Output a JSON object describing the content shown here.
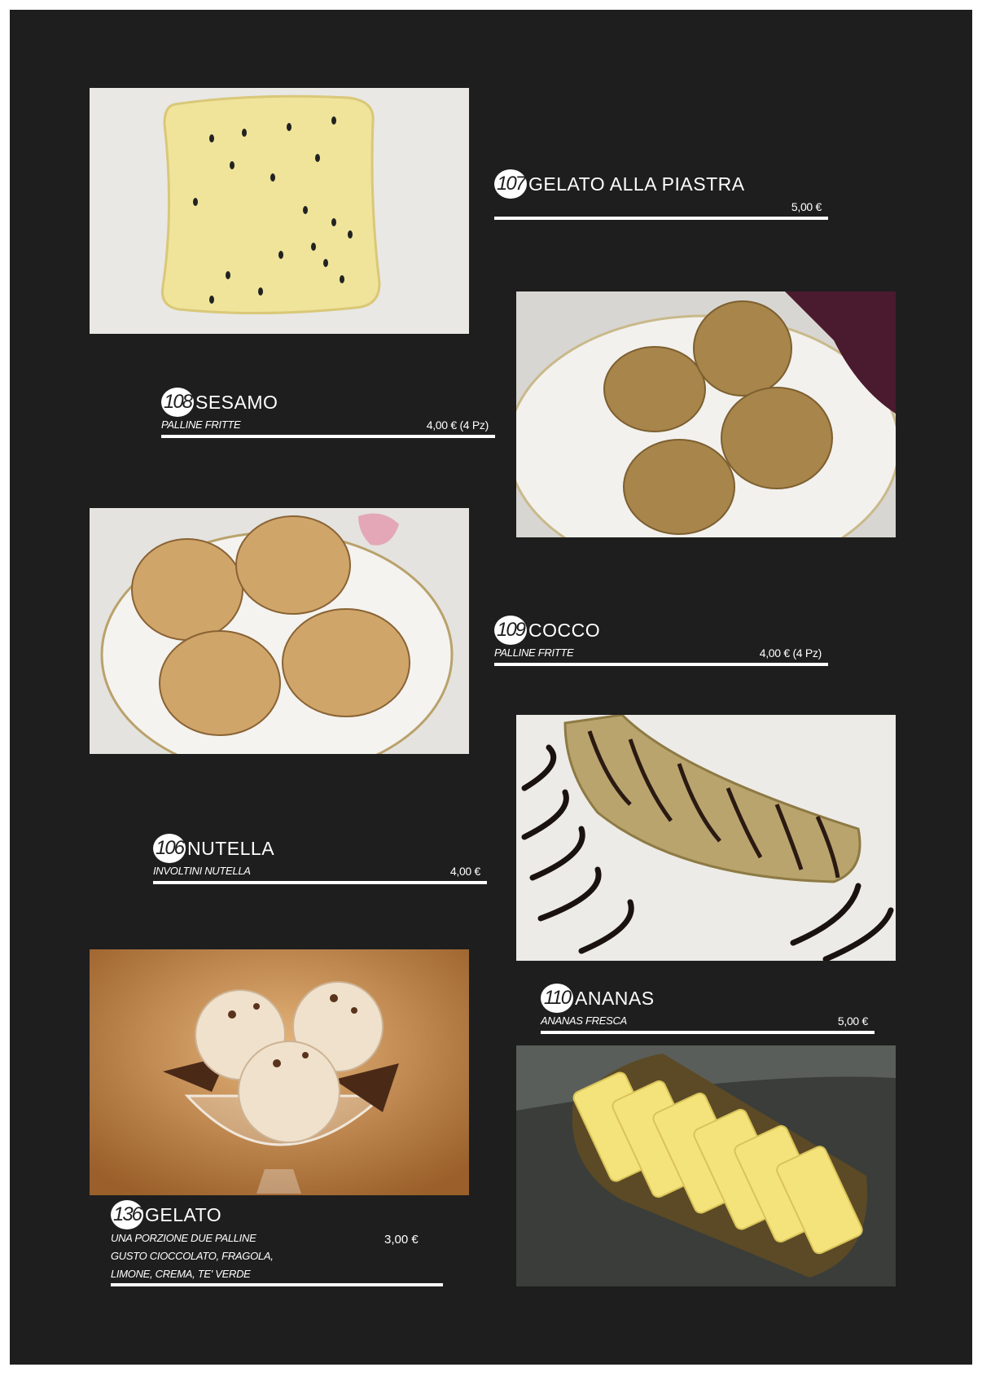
{
  "items": [
    {
      "num": "107",
      "name": "GELATO ALLA PIASTRA",
      "desc": "",
      "price": "5,00 €"
    },
    {
      "num": "108",
      "name": "SESAMO",
      "desc": "PALLINE FRITTE",
      "price": "4,00 € (4 Pz)"
    },
    {
      "num": "109",
      "name": "COCCO",
      "desc": "PALLINE FRITTE",
      "price": "4,00 € (4 Pz)"
    },
    {
      "num": "106",
      "name": "NUTELLA",
      "desc": "INVOLTINI NUTELLA",
      "price": "4,00 €"
    },
    {
      "num": "110",
      "name": "ANANAS",
      "desc": "ANANAS FRESCA",
      "price": "5,00 €"
    },
    {
      "num": "136",
      "name": "GELATO",
      "desc_lines": [
        "UNA PORZIONE DUE PALLINE",
        "GUSTO CIOCCOLATO, FRAGOLA,",
        "LIMONE, CREMA, TE' VERDE"
      ],
      "price": "3,00 €"
    }
  ],
  "colors": {
    "background": "#1e1e1e",
    "text": "#ffffff"
  }
}
